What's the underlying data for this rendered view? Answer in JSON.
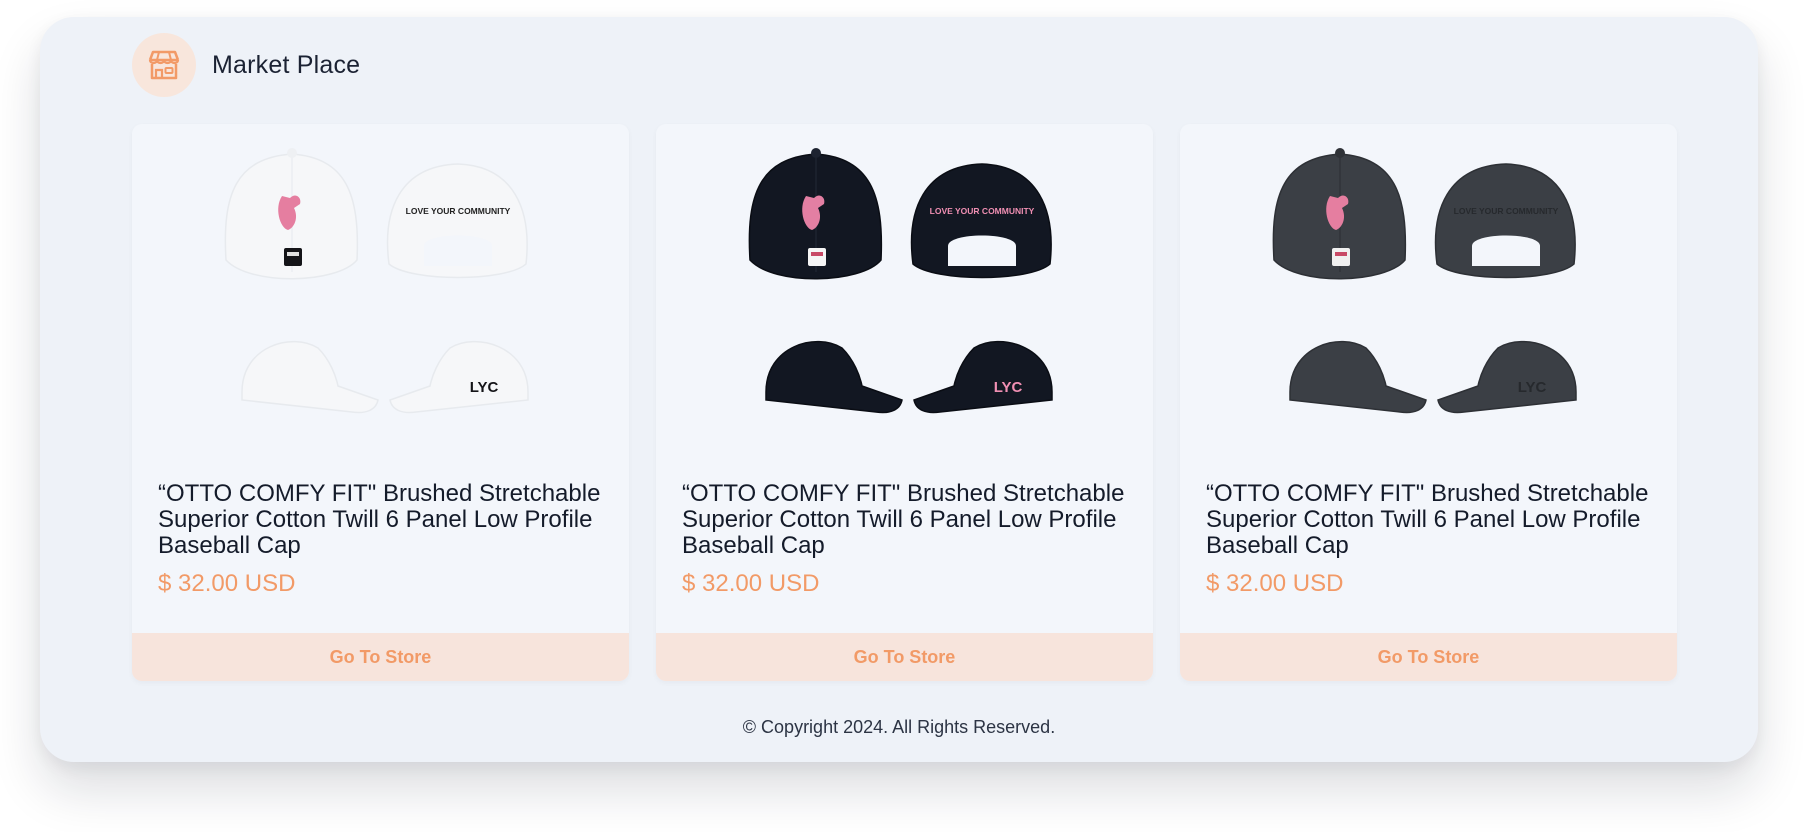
{
  "app": {
    "title": "Market Place",
    "icon": "storefront-icon",
    "accent_color": "#f29a67",
    "button_bg_color": "#f7e4dc"
  },
  "products": [
    {
      "title": "“OTTO COMFY FIT\" Brushed Stretchable Superior Cotton Twill 6 Panel Low Profile Baseball Cap",
      "price": "$ 32.00 USD",
      "button_label": "Go To Store",
      "image": "white-baseball-cap-four-views",
      "cap_color": "#f6f7f9"
    },
    {
      "title": "“OTTO COMFY FIT\" Brushed Stretchable Superior Cotton Twill 6 Panel Low Profile Baseball Cap",
      "price": "$ 32.00 USD",
      "button_label": "Go To Store",
      "image": "black-baseball-cap-four-views",
      "cap_color": "#121722"
    },
    {
      "title": "“OTTO COMFY FIT\" Brushed Stretchable Superior Cotton Twill 6 Panel Low Profile Baseball Cap",
      "price": "$ 32.00 USD",
      "button_label": "Go To Store",
      "image": "charcoal-baseball-cap-four-views",
      "cap_color": "#3b3f45"
    }
  ],
  "cap_print": {
    "back_text": "LOVE YOUR COMMUNITY",
    "side_text": "LYC"
  },
  "footer": {
    "copyright": "© Copyright 2024. All Rights Reserved."
  }
}
